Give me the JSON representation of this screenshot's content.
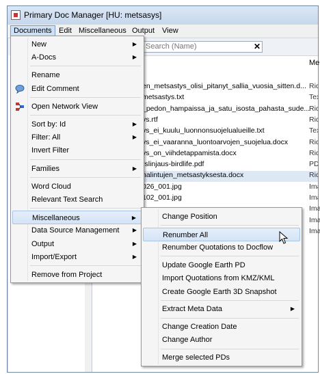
{
  "window": {
    "title": "Primary Doc Manager [HU: metsasys]"
  },
  "menubar": [
    "Documents",
    "Edit",
    "Miscellaneous",
    "Output",
    "View"
  ],
  "search": {
    "placeholder": "Search (Name)"
  },
  "table": {
    "column_header": "Me",
    "rows": [
      {
        "name": "en_metsastys_olisi_pitanyt_sallia_vuosia_sitten.d...",
        "type": "Rich"
      },
      {
        "name": "metsastys.txt",
        "type": "Text"
      },
      {
        "name": "_pedon_hampaissa_ja_satu_isosta_pahasta_sude...",
        "type": "Rich"
      },
      {
        "name": "vs.rtf",
        "type": "Rich"
      },
      {
        "name": "vs_ei_kuulu_luonnonsuojelualueille.txt",
        "type": "Text"
      },
      {
        "name": "vs_ei_vaaranna_luontoarvojen_suojelua.docx",
        "type": "Rich"
      },
      {
        "name": "vs_on_viihdetappamista.docx",
        "type": "Rich"
      },
      {
        "name": "rslinjaus-birdlife.pdf",
        "type": "PDF"
      },
      {
        "name": "nalintujen_metsastyksesta.docx",
        "type": "Rich"
      },
      {
        "name": "026_001.jpg",
        "type": "Ima"
      },
      {
        "name": "102_001.jpg",
        "type": "Ima"
      }
    ],
    "extra_types": [
      "Ima",
      "Ima",
      "Ima"
    ]
  },
  "documents_menu": [
    {
      "label": "New",
      "submenu": true
    },
    {
      "label": "A-Docs",
      "submenu": true
    },
    {
      "separator": true
    },
    {
      "label": "Rename"
    },
    {
      "label": "Edit Comment",
      "icon": "comment-icon"
    },
    {
      "separator": true
    },
    {
      "label": "Open Network View",
      "icon": "network-icon"
    },
    {
      "separator": true
    },
    {
      "label": "Sort by: Id",
      "submenu": true
    },
    {
      "label": "Filter: All",
      "submenu": true
    },
    {
      "label": "Invert Filter"
    },
    {
      "separator": true
    },
    {
      "label": "Families",
      "submenu": true
    },
    {
      "separator": true
    },
    {
      "label": "Word Cloud"
    },
    {
      "label": "Relevant Text Search"
    },
    {
      "separator": true
    },
    {
      "label": "Miscellaneous",
      "submenu": true,
      "highlighted": true
    },
    {
      "label": "Data Source Management",
      "submenu": true
    },
    {
      "label": "Output",
      "submenu": true
    },
    {
      "label": "Import/Export",
      "submenu": true
    },
    {
      "separator": true
    },
    {
      "label": "Remove from Project"
    }
  ],
  "misc_submenu": [
    {
      "label": "Change Position"
    },
    {
      "separator": true
    },
    {
      "label": "Renumber All",
      "highlighted": true
    },
    {
      "label": "Renumber Quotations to Docflow"
    },
    {
      "separator": true
    },
    {
      "label": "Update Google Earth PD"
    },
    {
      "label": "Import Quotations from KMZ/KML"
    },
    {
      "label": "Create Google Earth 3D Snapshot"
    },
    {
      "separator": true
    },
    {
      "label": "Extract Meta Data",
      "submenu": true
    },
    {
      "separator": true
    },
    {
      "label": "Change Creation Date"
    },
    {
      "label": "Change Author"
    },
    {
      "separator": true
    },
    {
      "label": "Merge selected PDs"
    }
  ],
  "colors": {
    "highlight": "#d4e3f6",
    "window_frame": "#c8d9ec",
    "selected_row": "#dde8f5"
  }
}
